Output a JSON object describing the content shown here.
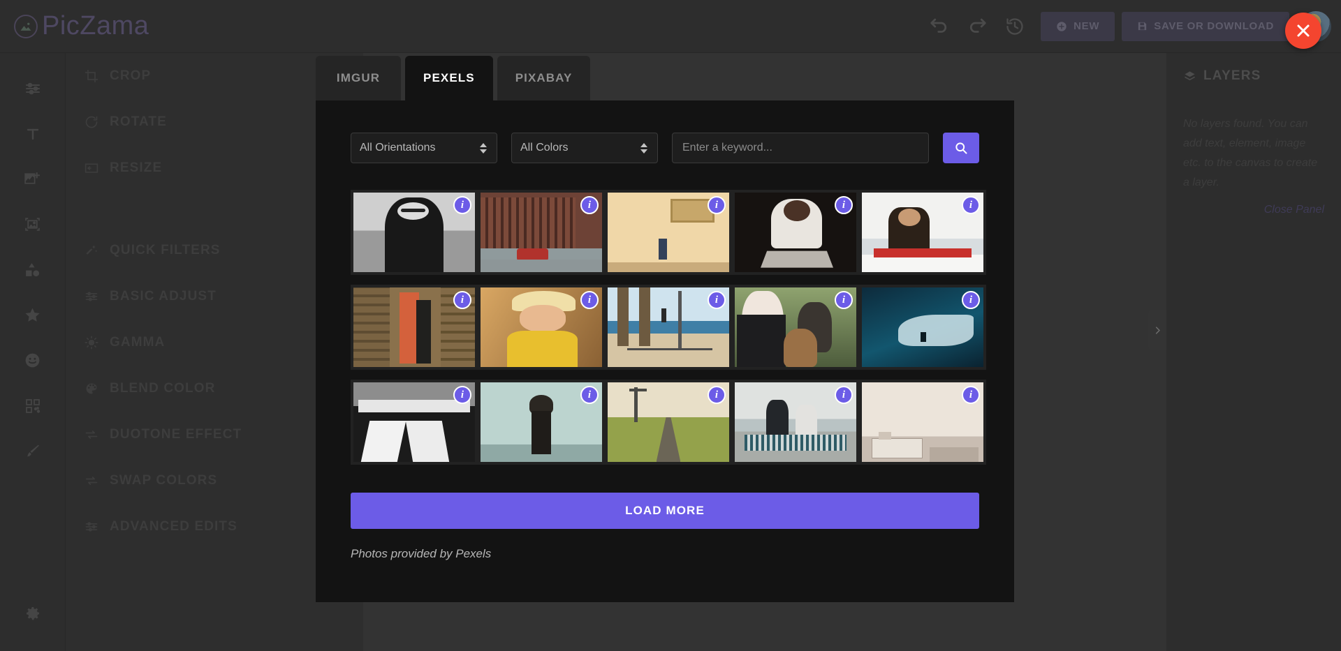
{
  "app": {
    "brand": "PicZama",
    "logo_icon": "image-circle-icon"
  },
  "toolbar": {
    "undo_icon": "undo-icon",
    "redo_icon": "redo-icon",
    "history_icon": "history-icon",
    "new_label": "NEW",
    "save_label": "SAVE OR DOWNLOAD",
    "close_icon": "close-icon",
    "avatar_icon": "user-avatar"
  },
  "rail": {
    "items": [
      {
        "icon": "sliders-icon",
        "name": "adjust"
      },
      {
        "icon": "text-icon",
        "name": "text"
      },
      {
        "icon": "add-image-icon",
        "name": "add-image"
      },
      {
        "icon": "frame-icon",
        "name": "frame"
      },
      {
        "icon": "shapes-icon",
        "name": "shapes"
      },
      {
        "icon": "star-icon",
        "name": "star"
      },
      {
        "icon": "emoji-icon",
        "name": "emoji"
      },
      {
        "icon": "sticker-grid-icon",
        "name": "stickers"
      },
      {
        "icon": "brush-icon",
        "name": "brush"
      }
    ],
    "settings_icon": "gear-icon"
  },
  "menu": {
    "items": [
      {
        "label": "CROP",
        "icon": "crop-icon"
      },
      {
        "label": "ROTATE",
        "icon": "rotate-icon"
      },
      {
        "label": "RESIZE",
        "icon": "resize-icon"
      },
      {
        "label": "QUICK FILTERS",
        "icon": "magic-wand-icon"
      },
      {
        "label": "BASIC ADJUST",
        "icon": "sliders-icon"
      },
      {
        "label": "GAMMA",
        "icon": "brightness-icon"
      },
      {
        "label": "BLEND COLOR",
        "icon": "palette-icon"
      },
      {
        "label": "DUOTONE EFFECT",
        "icon": "duotone-icon"
      },
      {
        "label": "SWAP COLORS",
        "icon": "swap-icon"
      },
      {
        "label": "ADVANCED EDITS",
        "icon": "sliders-icon"
      }
    ]
  },
  "layers": {
    "title": "LAYERS",
    "icon": "layers-icon",
    "empty_text": "No layers found. You can add text, element, image etc. to the canvas to create a layer.",
    "close_panel_label": "Close Panel",
    "collapse_icon": "chevron-right-icon"
  },
  "modal": {
    "tabs": [
      {
        "label": "IMGUR",
        "active": false
      },
      {
        "label": "PEXELS",
        "active": true
      },
      {
        "label": "PIXABAY",
        "active": false
      }
    ],
    "search": {
      "orientation_value": "All Orientations",
      "color_value": "All Colors",
      "keyword_value": "",
      "keyword_placeholder": "Enter a keyword...",
      "search_icon": "search-icon"
    },
    "results": [
      {
        "alt": "black and white portrait of woman with sunglasses at beach",
        "badge": "i"
      },
      {
        "alt": "red brick victorian building with vintage red car",
        "badge": "i"
      },
      {
        "alt": "person walking past yellow wall with window",
        "badge": "i"
      },
      {
        "alt": "man in white shirt working on laptop in dark room",
        "badge": "i"
      },
      {
        "alt": "woman in red by the sea talking on phone",
        "badge": "i"
      },
      {
        "alt": "person in dress standing in stone ruin doorway",
        "badge": "i"
      },
      {
        "alt": "toddler in yellow shirt and straw hat in sand",
        "badge": "i"
      },
      {
        "alt": "palm trees and gymnast on beach boardwalk",
        "badge": "i"
      },
      {
        "alt": "blonde woman in black jacket holding two dogs",
        "badge": "i"
      },
      {
        "alt": "surfer riding a dark blue ocean wave",
        "badge": "i"
      },
      {
        "alt": "black and white folding chairs on a deck",
        "badge": "i"
      },
      {
        "alt": "woman in black dress against pale green wall",
        "badge": "i"
      },
      {
        "alt": "railway tracks running through green fields",
        "badge": "i"
      },
      {
        "alt": "elderly couple on bench looking at the sea",
        "badge": "i"
      },
      {
        "alt": "ferry boat on hazy harbour at dusk",
        "badge": "i"
      }
    ],
    "load_more_label": "LOAD MORE",
    "credit": "Photos provided by Pexels"
  },
  "colors": {
    "accent": "#6c5ce7",
    "close": "#f4452f",
    "modal_bg": "#131313",
    "panel_bg": "#2d2d2d"
  }
}
